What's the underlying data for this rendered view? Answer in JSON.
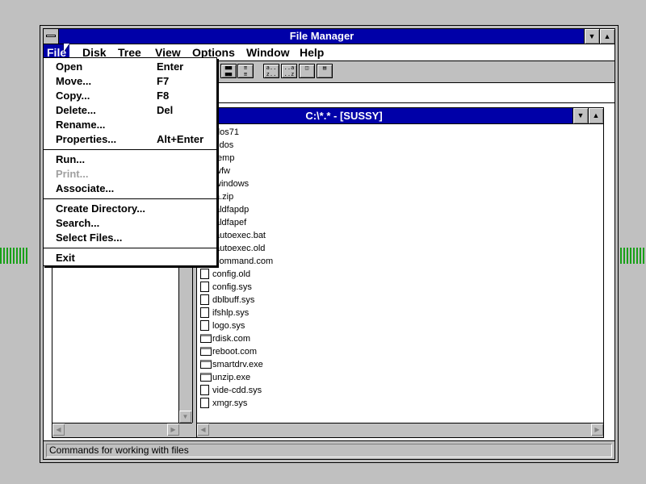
{
  "window": {
    "title": "File Manager"
  },
  "menubar": [
    "File",
    "Disk",
    "Tree",
    "View",
    "Options",
    "Window",
    "Help"
  ],
  "directory_window": {
    "title": "C:\\*.* - [SUSSY]"
  },
  "files": [
    {
      "name": "dos71",
      "type": "folder"
    },
    {
      "name": "sdos",
      "type": "folder"
    },
    {
      "name": "temp",
      "type": "folder"
    },
    {
      "name": "wfw",
      "type": "folder"
    },
    {
      "name": "windows",
      "type": "folder"
    },
    {
      "name": "a.zip",
      "type": "doc"
    },
    {
      "name": "aldfapdp",
      "type": "doc"
    },
    {
      "name": "aldfapef",
      "type": "doc"
    },
    {
      "name": "autoexec.bat",
      "type": "doc"
    },
    {
      "name": "autoexec.old",
      "type": "doc"
    },
    {
      "name": "command.com",
      "type": "doc"
    },
    {
      "name": "config.old",
      "type": "doc"
    },
    {
      "name": "config.sys",
      "type": "doc"
    },
    {
      "name": "dblbuff.sys",
      "type": "doc"
    },
    {
      "name": "ifshlp.sys",
      "type": "doc"
    },
    {
      "name": "logo.sys",
      "type": "doc"
    },
    {
      "name": "rdisk.com",
      "type": "exe"
    },
    {
      "name": "reboot.com",
      "type": "exe"
    },
    {
      "name": "smartdrv.exe",
      "type": "exe"
    },
    {
      "name": "unzip.exe",
      "type": "exe"
    },
    {
      "name": "vide-cdd.sys",
      "type": "doc"
    },
    {
      "name": "xmgr.sys",
      "type": "doc"
    }
  ],
  "file_menu": [
    {
      "label": "Open",
      "key": "Enter"
    },
    {
      "label": "Move...",
      "key": "F7"
    },
    {
      "label": "Copy...",
      "key": "F8"
    },
    {
      "label": "Delete...",
      "key": "Del"
    },
    {
      "label": "Rename...",
      "key": ""
    },
    {
      "label": "Properties...",
      "key": "Alt+Enter"
    },
    {
      "sep": true
    },
    {
      "label": "Run...",
      "key": ""
    },
    {
      "label": "Print...",
      "key": "",
      "disabled": true
    },
    {
      "label": "Associate...",
      "key": ""
    },
    {
      "sep": true
    },
    {
      "label": "Create Directory...",
      "key": ""
    },
    {
      "label": "Search...",
      "key": ""
    },
    {
      "label": "Select Files...",
      "key": ""
    },
    {
      "sep": true
    },
    {
      "label": "Exit",
      "key": ""
    }
  ],
  "status": {
    "text": "Commands for working with files"
  },
  "toolbar_icons": [
    "details-icon",
    "list-icon",
    "sort-name-icon",
    "sort-type-icon",
    "search-icon",
    "sort-size-icon"
  ]
}
